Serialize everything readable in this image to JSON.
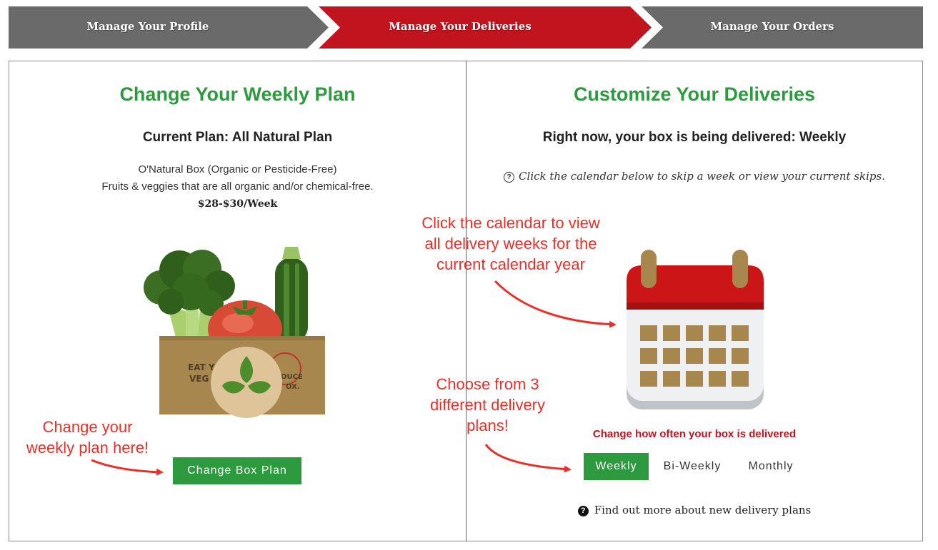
{
  "nav": {
    "steps": [
      {
        "label": "Manage Your Profile",
        "state": "inactive"
      },
      {
        "label": "Manage Your Deliveries",
        "state": "active"
      },
      {
        "label": "Manage Your Orders",
        "state": "inactive"
      }
    ],
    "colors": {
      "active": "#c0141f",
      "inactive": "#6a6a6a"
    }
  },
  "left": {
    "title": "Change Your Weekly Plan",
    "current_plan": "Current Plan: All Natural Plan",
    "plan_box": "O'Natural Box (Organic or Pesticide-Free)",
    "plan_description": "Fruits & veggies that are all organic and/or chemical-free.",
    "price": "$28-$30/Week",
    "box_text": {
      "line1": "EAT Y",
      "line2": "VEG",
      "right1": "OUCE",
      "right2": "OX."
    },
    "change_button": "Change Box Plan"
  },
  "right": {
    "title": "Customize Your Deliveries",
    "delivery_status": "Right now, your box is being delivered: Weekly",
    "skip_note": "Click the calendar below to skip a week or view your current skips.",
    "frequency_label": "Change how often your box is delivered",
    "frequency_options": [
      "Weekly",
      "Bi-Weekly",
      "Monthly"
    ],
    "selected_frequency": "Weekly",
    "more_link": "Find out more about new delivery plans"
  },
  "annotations": {
    "weekly_plan": [
      "Change your",
      "weekly plan here!"
    ],
    "calendar": [
      "Click the calendar to view",
      "all delivery weeks for the",
      "current calendar year"
    ],
    "delivery_plans": [
      "Choose from 3",
      "different delivery",
      "plans!"
    ]
  },
  "icons": {
    "calendar": "calendar-icon",
    "produce_box": "produce-box-illustration",
    "help": "question-circle-icon"
  },
  "colors": {
    "brand_green": "#2e9a3f",
    "brand_red": "#c0141f",
    "annotation_red": "#e8302a"
  }
}
